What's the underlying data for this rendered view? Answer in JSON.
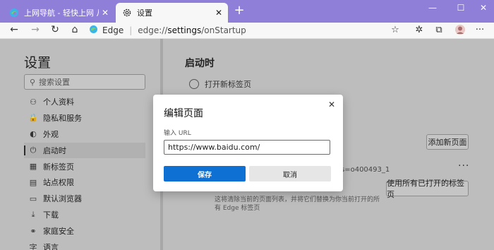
{
  "browser": {
    "tabs": [
      {
        "title": "上网导航 - 轻快上网 从这里开始",
        "icon": "edge-logo-icon"
      },
      {
        "title": "设置",
        "icon": "gear-icon"
      }
    ],
    "tab_close": "✕",
    "new_tab": "+",
    "window_controls": {
      "minimize": "—",
      "maximize": "☐",
      "close": "✕"
    },
    "address": {
      "brand": "Edge",
      "separator": "|",
      "url_prefix": "edge://",
      "url_bold": "settings",
      "url_suffix": "/onStartup"
    },
    "accent_color": "#8f7fd9"
  },
  "sidebar": {
    "title": "设置",
    "search_placeholder": "搜索设置",
    "items": [
      {
        "label": "个人资料",
        "icon": "person-icon",
        "glyph": "⚇"
      },
      {
        "label": "隐私和服务",
        "icon": "lock-icon",
        "glyph": "🔒"
      },
      {
        "label": "外观",
        "icon": "palette-icon",
        "glyph": "◐"
      },
      {
        "label": "启动时",
        "icon": "power-icon",
        "glyph": "⏻",
        "selected": true
      },
      {
        "label": "新标签页",
        "icon": "new-tab-icon",
        "glyph": "▦"
      },
      {
        "label": "站点权限",
        "icon": "site-permissions-icon",
        "glyph": "▤"
      },
      {
        "label": "默认浏览器",
        "icon": "browser-icon",
        "glyph": "▭"
      },
      {
        "label": "下载",
        "icon": "download-icon",
        "glyph": "⤓"
      },
      {
        "label": "家庭安全",
        "icon": "family-icon",
        "glyph": "⚭"
      },
      {
        "label": "语言",
        "icon": "language-icon",
        "glyph": "字"
      }
    ]
  },
  "main": {
    "title": "启动时",
    "radio_label": "打开新标签页",
    "add_page_button": "添加新页面",
    "more_button": "···",
    "partial_url": "s=o400493_1",
    "use_open_tabs_button": "使用所有已打开的标签页",
    "description": "这将清除当前的页面列表，并将它们替换为你当前打开的所有 Edge 标签页"
  },
  "dialog": {
    "title": "编辑页面",
    "close": "✕",
    "url_label": "输入 URL",
    "url_value": "https://www.baidu.com/",
    "save_label": "保存",
    "cancel_label": "取消",
    "save_color": "#0f70d3"
  }
}
